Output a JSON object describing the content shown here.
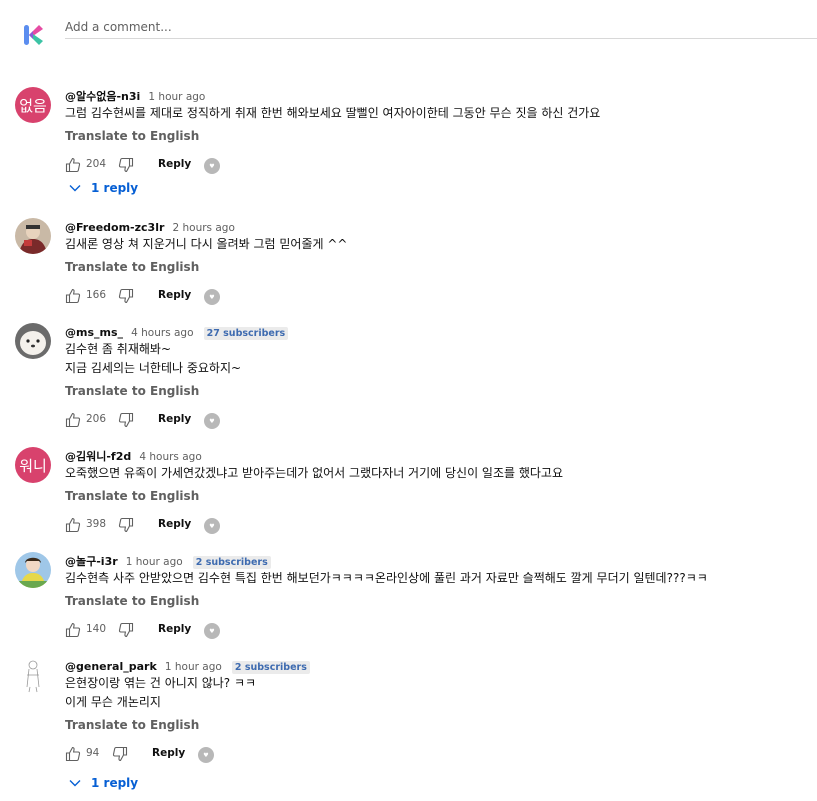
{
  "add_comment": {
    "placeholder": "Add a comment..."
  },
  "actions": {
    "translate_label": "Translate to English",
    "reply_label": "Reply"
  },
  "colors": {
    "link_blue": "#065fd4",
    "avatar_pink": "#d8426d",
    "meta_gray": "#606060"
  },
  "comments": [
    {
      "author": "@알수없음-n3i",
      "time": "1 hour ago",
      "avatar_text": "없음",
      "lines": [
        "그럼 김수현씨를 제대로 정직하게 취재 한번 해와보세요 딸뻘인 여자아이한테 그동안 무슨 짓을 하신 건가요"
      ],
      "likes": "204",
      "replies_label": "1 reply"
    },
    {
      "author": "@Freedom-zc3lr",
      "time": "2 hours ago",
      "lines": [
        "김새론 영상 쳐 지운거니 다시 올려봐 그럼 믿어줄게 ^^"
      ],
      "likes": "166"
    },
    {
      "author": "@ms_ms_",
      "time": "4 hours ago",
      "subscribers": "27 subscribers",
      "lines": [
        "김수현 좀 취재해봐~",
        "지금 김세의는 너한테나 중요하지~"
      ],
      "likes": "206"
    },
    {
      "author": "@김워니-f2d",
      "time": "4 hours ago",
      "avatar_text": "워니",
      "lines": [
        "오죽했으면 유족이 가세연갔겠냐고 받아주는데가 없어서 그랬다자너 거기에 당신이 일조를 했다고요"
      ],
      "likes": "398"
    },
    {
      "author": "@놀구-i3r",
      "time": "1 hour ago",
      "subscribers": "2 subscribers",
      "lines": [
        "김수현측 사주 안받았으면 김수현 특집 한번 해보던가ㅋㅋㅋㅋ온라인상에 풀린 과거 자료만 슬쩍해도 깔게 무더기 일텐데???ㅋㅋ"
      ],
      "likes": "140"
    },
    {
      "author": "@general_park",
      "time": "1 hour ago",
      "subscribers": "2 subscribers",
      "lines": [
        "은현장이랑 엮는 건 아니지 않나? ㅋㅋ",
        "이게 무슨 개논리지"
      ],
      "likes": "94",
      "replies_label": "1 reply"
    }
  ]
}
